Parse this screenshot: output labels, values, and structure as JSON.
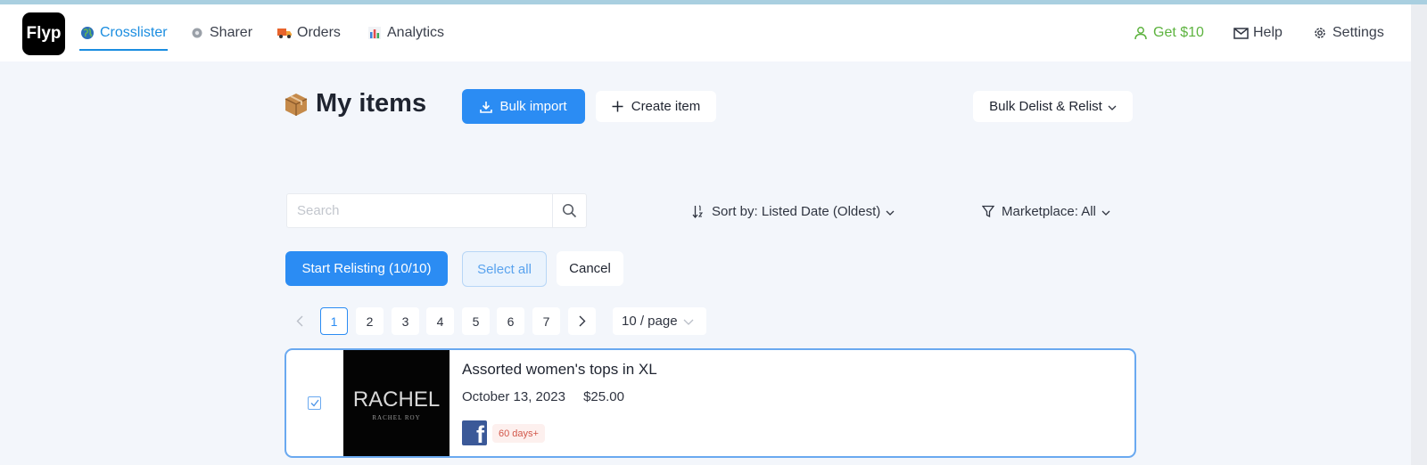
{
  "app": {
    "logo_text": "Flyp",
    "accent_color": "#2b8cf3",
    "success_color": "#5db33f"
  },
  "nav": {
    "items": [
      {
        "label": "Crosslister",
        "icon": "globe-icon",
        "active": true
      },
      {
        "label": "Sharer",
        "icon": "gear-small-icon",
        "active": false
      },
      {
        "label": "Orders",
        "icon": "truck-icon",
        "active": false
      },
      {
        "label": "Analytics",
        "icon": "bar-chart-icon",
        "active": false
      }
    ],
    "right": [
      {
        "label": "Get $10",
        "icon": "user-icon"
      },
      {
        "label": "Help",
        "icon": "mail-icon"
      },
      {
        "label": "Settings",
        "icon": "gear-icon"
      }
    ]
  },
  "page": {
    "title": "My items",
    "title_icon": "package-icon",
    "bulk_import_label": "Bulk import",
    "create_item_label": "Create item",
    "bulk_delist_label": "Bulk Delist & Relist"
  },
  "filters": {
    "search_placeholder": "Search",
    "search_value": "",
    "sort_label": "Sort by: Listed Date (Oldest)",
    "marketplace_label": "Marketplace: All"
  },
  "actions": {
    "start_relisting_label": "Start Relisting (10/10)",
    "select_all_label": "Select all",
    "cancel_label": "Cancel"
  },
  "pagination": {
    "pages": [
      "1",
      "2",
      "3",
      "4",
      "5",
      "6",
      "7"
    ],
    "current": "1",
    "per_page": "10 / page"
  },
  "items": [
    {
      "title": "Assorted women's tops in XL",
      "date": "October 13, 2023",
      "price": "$25.00",
      "checked": true,
      "thumb_brand": "RACHEL",
      "thumb_sub": "RACHEL ROY",
      "marketplace_icon": "facebook-icon",
      "age_badge": "60 days+"
    }
  ]
}
